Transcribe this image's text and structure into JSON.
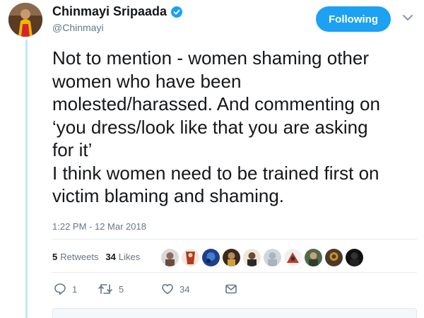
{
  "author": {
    "display_name": "Chinmayi Sripaada",
    "handle": "@Chinmayi",
    "verified": true
  },
  "follow_button": {
    "label": "Following"
  },
  "tweet": {
    "lines": [
      "Not to mention - women shaming other",
      "women who have been",
      "molested/harassed. And commenting on",
      "‘you dress/look like that you are asking",
      "for it’",
      "I think women need to be trained first on",
      "victim blaming and shaming."
    ],
    "timestamp": "1:22 PM - 12 Mar 2018"
  },
  "stats": {
    "retweets_count": "5",
    "retweets_label": "Retweets",
    "likes_count": "34",
    "likes_label": "Likes"
  },
  "actions": {
    "reply_count": "1",
    "retweet_count": "5",
    "like_count": "34"
  },
  "colors": {
    "accent": "#1da1f2",
    "thread_line": "#c4e7f5",
    "secondary_text": "#657786"
  }
}
